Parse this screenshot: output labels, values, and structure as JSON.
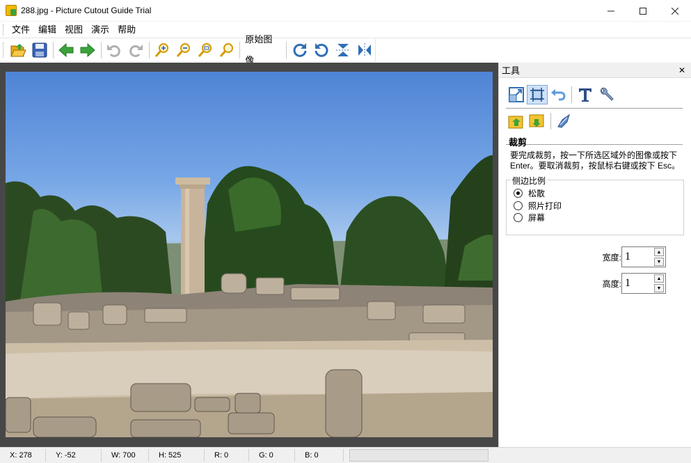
{
  "window": {
    "title": "288.jpg - Picture Cutout Guide Trial",
    "controls": {
      "minimize": "—",
      "maximize": "☐",
      "close": "✕"
    }
  },
  "menu": {
    "items": [
      "文件",
      "编辑",
      "视图",
      "演示",
      "帮助"
    ]
  },
  "toolbar": {
    "original_image_label": "原始图像",
    "icons": [
      "open-folder",
      "save-disk",
      "back-arrow",
      "forward-arrow",
      "undo",
      "redo",
      "zoom-in",
      "zoom-out",
      "zoom-fit",
      "zoom-actual",
      "rotate-right",
      "rotate-left",
      "flip-vertical",
      "flip-horizontal"
    ]
  },
  "panel": {
    "title": "工具",
    "close_symbol": "✕",
    "section_title": "裁剪",
    "description": "要完成裁剪，按一下所选区域外的图像或按下Enter。要取消裁剪，按鼠标右键或按下 Esc。",
    "aspect": {
      "title": "侧边比例",
      "options": [
        {
          "label": "松散",
          "checked": true
        },
        {
          "label": "照片打印",
          "checked": false
        },
        {
          "label": "屏幕",
          "checked": false
        }
      ]
    },
    "width": {
      "label": "宽度:",
      "value": "1"
    },
    "height": {
      "label": "高度:",
      "value": "1"
    }
  },
  "status": {
    "x": "X: 278",
    "y": "Y: -52",
    "w": "W: 700",
    "h": "H: 525",
    "r": "R: 0",
    "g": "G: 0",
    "b": "B: 0",
    "progress": 0
  },
  "colors": {
    "canvas_bg": "#474747",
    "accent_green": "#3ca23c",
    "accent_yellow": "#f5b800",
    "tool_blue": "#2f6fb5"
  }
}
